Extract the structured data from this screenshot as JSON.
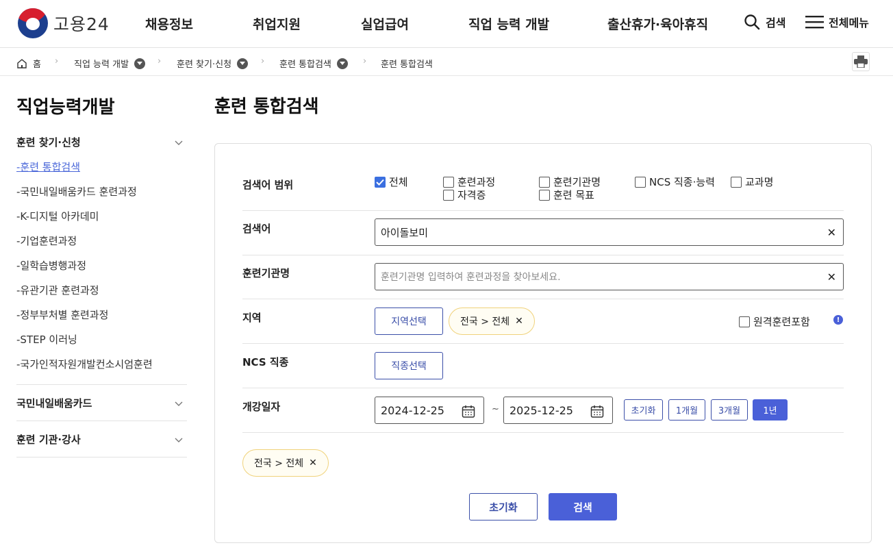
{
  "header": {
    "logo_text": "고용24",
    "nav": [
      "채용정보",
      "취업지원",
      "실업급여",
      "직업 능력 개발",
      "출산휴가·육아휴직"
    ],
    "search_label": "검색",
    "all_menu_label": "전체메뉴"
  },
  "breadcrumb": {
    "home": "홈",
    "items": [
      "직업 능력 개발",
      "훈련 찾기·신청",
      "훈련 통합검색",
      "훈련 통합검색"
    ]
  },
  "sidebar": {
    "title": "직업능력개발",
    "sections": [
      {
        "label": "훈련 찾기·신청",
        "items": [
          "훈련 통합검색",
          "국민내일배움카드 훈련과정",
          "K-디지털 아카데미",
          "기업훈련과정",
          "일학습병행과정",
          "유관기관 훈련과정",
          "정부부처별 훈련과정",
          "STEP 이러닝",
          "국가인적자원개발컨소시엄훈련"
        ]
      },
      {
        "label": "국민내일배움카드"
      },
      {
        "label": "훈련 기관·강사"
      }
    ]
  },
  "main": {
    "title": "훈련 통합검색",
    "scope": {
      "label": "검색어 범위",
      "options": [
        {
          "label": "전체",
          "checked": true
        },
        {
          "label": "훈련과정",
          "checked": false
        },
        {
          "label": "자격증",
          "checked": false
        },
        {
          "label": "훈련기관명",
          "checked": false
        },
        {
          "label": "훈련 목표",
          "checked": false
        },
        {
          "label": "NCS 직종·능력",
          "checked": false
        },
        {
          "label": "교과명",
          "checked": false
        }
      ]
    },
    "keyword": {
      "label": "검색어",
      "value": "아이돌보미"
    },
    "institution": {
      "label": "훈련기관명",
      "placeholder": "훈련기관명 입력하여 훈련과정을 찾아보세요."
    },
    "region": {
      "label": "지역",
      "button": "지역선택",
      "chip": "전국 > 전체",
      "remote_label": "원격훈련포함"
    },
    "ncs": {
      "label": "NCS 직종",
      "button": "직종선택"
    },
    "date": {
      "label": "개강일자",
      "start": "2024-12-25",
      "end": "2025-12-25",
      "tilde": "~",
      "presets": [
        "초기화",
        "1개월",
        "3개월",
        "1년"
      ],
      "active_preset": "1년"
    },
    "selected_chip": "전국 > 전체",
    "reset_button": "초기화",
    "search_button": "검색"
  },
  "colors": {
    "accent": "#4a60d8",
    "chip_border": "#f0d27a",
    "active_link": "#4a67d9"
  }
}
